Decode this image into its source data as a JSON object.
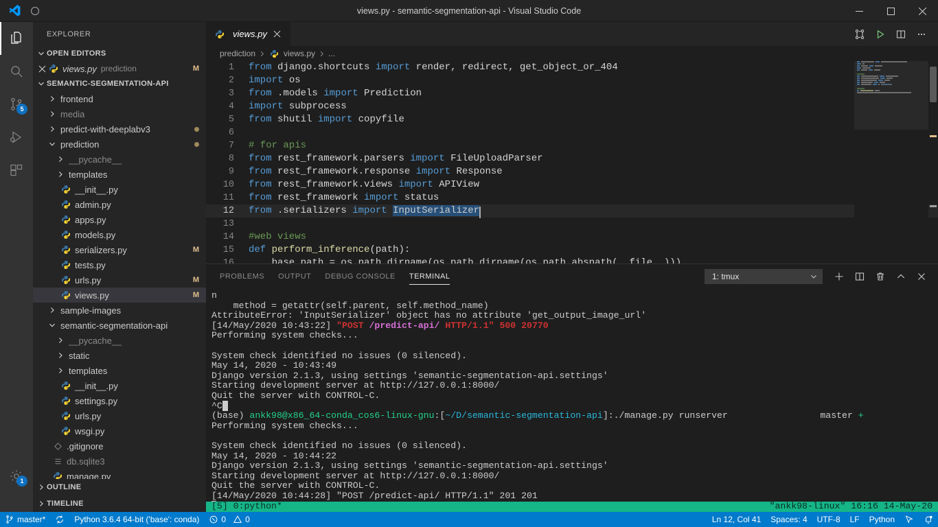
{
  "titlebar": {
    "title": "views.py - semantic-segmentation-api - Visual Studio Code",
    "logo_name": "vscode-logo",
    "minimize": "─",
    "maximize": "□",
    "close": "✕"
  },
  "activitybar": {
    "items": [
      {
        "name": "explorer",
        "icon": "files-icon",
        "badge": ""
      },
      {
        "name": "search",
        "icon": "search-icon",
        "badge": ""
      },
      {
        "name": "source-control",
        "icon": "source-control-icon",
        "badge": "5"
      },
      {
        "name": "run-and-debug",
        "icon": "run-debug-icon",
        "badge": ""
      },
      {
        "name": "extensions",
        "icon": "extensions-icon",
        "badge": ""
      }
    ],
    "bottom": [
      {
        "name": "manage",
        "icon": "gear-icon",
        "badge": "1"
      }
    ]
  },
  "sidebar": {
    "title": "EXPLORER",
    "open_editors": {
      "header": "OPEN EDITORS",
      "items": [
        {
          "name": "views.py",
          "description": "prediction",
          "badge": "M",
          "icon": "python-icon"
        }
      ]
    },
    "project": {
      "header": "SEMANTIC-SEGMENTATION-API",
      "items": [
        {
          "label": "frontend",
          "type": "folder",
          "indent": 1,
          "expanded": false,
          "badge": "",
          "dim": false
        },
        {
          "label": "media",
          "type": "folder",
          "indent": 1,
          "expanded": false,
          "badge": "",
          "dim": true
        },
        {
          "label": "predict-with-deeplabv3",
          "type": "folder",
          "indent": 1,
          "expanded": false,
          "badge": "dot",
          "dim": false
        },
        {
          "label": "prediction",
          "type": "folder",
          "indent": 1,
          "expanded": true,
          "badge": "dot",
          "dim": false
        },
        {
          "label": "__pycache__",
          "type": "folder",
          "indent": 2,
          "expanded": false,
          "badge": "",
          "dim": true
        },
        {
          "label": "templates",
          "type": "folder",
          "indent": 2,
          "expanded": false,
          "badge": "",
          "dim": false
        },
        {
          "label": "__init__.py",
          "type": "python",
          "indent": 2,
          "badge": "",
          "dim": false
        },
        {
          "label": "admin.py",
          "type": "python",
          "indent": 2,
          "badge": "",
          "dim": false
        },
        {
          "label": "apps.py",
          "type": "python",
          "indent": 2,
          "badge": "",
          "dim": false
        },
        {
          "label": "models.py",
          "type": "python",
          "indent": 2,
          "badge": "",
          "dim": false
        },
        {
          "label": "serializers.py",
          "type": "python",
          "indent": 2,
          "badge": "M",
          "dim": false
        },
        {
          "label": "tests.py",
          "type": "python",
          "indent": 2,
          "badge": "",
          "dim": false
        },
        {
          "label": "urls.py",
          "type": "python",
          "indent": 2,
          "badge": "M",
          "dim": false
        },
        {
          "label": "views.py",
          "type": "python",
          "indent": 2,
          "badge": "M",
          "dim": false,
          "selected": true
        },
        {
          "label": "sample-images",
          "type": "folder",
          "indent": 1,
          "expanded": false,
          "badge": "",
          "dim": false
        },
        {
          "label": "semantic-segmentation-api",
          "type": "folder",
          "indent": 1,
          "expanded": true,
          "badge": "",
          "dim": false
        },
        {
          "label": "__pycache__",
          "type": "folder",
          "indent": 2,
          "expanded": false,
          "badge": "",
          "dim": true
        },
        {
          "label": "static",
          "type": "folder",
          "indent": 2,
          "expanded": false,
          "badge": "",
          "dim": false
        },
        {
          "label": "templates",
          "type": "folder",
          "indent": 2,
          "expanded": false,
          "badge": "",
          "dim": false
        },
        {
          "label": "__init__.py",
          "type": "python",
          "indent": 2,
          "badge": "",
          "dim": false
        },
        {
          "label": "settings.py",
          "type": "python",
          "indent": 2,
          "badge": "",
          "dim": false
        },
        {
          "label": "urls.py",
          "type": "python",
          "indent": 2,
          "badge": "",
          "dim": false
        },
        {
          "label": "wsgi.py",
          "type": "python",
          "indent": 2,
          "badge": "",
          "dim": false
        },
        {
          "label": ".gitignore",
          "type": "git",
          "indent": 1,
          "badge": "",
          "dim": false
        },
        {
          "label": "db.sqlite3",
          "type": "db",
          "indent": 1,
          "badge": "",
          "dim": true
        },
        {
          "label": "manage.py",
          "type": "python",
          "indent": 1,
          "badge": "",
          "dim": false
        }
      ]
    },
    "outline_header": "OUTLINE",
    "timeline_header": "TIMELINE"
  },
  "editor": {
    "tab": {
      "label": "views.py",
      "icon": "python-icon",
      "close": "✕",
      "preview": true
    },
    "actions": [
      {
        "name": "open-changes-icon"
      },
      {
        "name": "run-python-file-icon"
      },
      {
        "name": "split-editor-icon"
      },
      {
        "name": "more-actions-icon"
      }
    ],
    "breadcrumb": [
      "prediction",
      "views.py",
      "..."
    ],
    "lines": [
      {
        "n": 1,
        "tokens": [
          [
            "kw",
            "from"
          ],
          [
            "pl",
            " django.shortcuts "
          ],
          [
            "kw",
            "import"
          ],
          [
            "pl",
            " render, redirect, get_object_or_404"
          ]
        ]
      },
      {
        "n": 2,
        "tokens": [
          [
            "kw",
            "import"
          ],
          [
            "pl",
            " os"
          ]
        ]
      },
      {
        "n": 3,
        "tokens": [
          [
            "kw",
            "from"
          ],
          [
            "pl",
            " .models "
          ],
          [
            "kw",
            "import"
          ],
          [
            "pl",
            " Prediction"
          ]
        ]
      },
      {
        "n": 4,
        "tokens": [
          [
            "kw",
            "import"
          ],
          [
            "pl",
            " subprocess"
          ]
        ]
      },
      {
        "n": 5,
        "tokens": [
          [
            "kw",
            "from"
          ],
          [
            "pl",
            " shutil "
          ],
          [
            "kw",
            "import"
          ],
          [
            "pl",
            " copyfile"
          ]
        ]
      },
      {
        "n": 6,
        "tokens": []
      },
      {
        "n": 7,
        "tokens": [
          [
            "cm",
            "# for apis"
          ]
        ]
      },
      {
        "n": 8,
        "tokens": [
          [
            "kw",
            "from"
          ],
          [
            "pl",
            " rest_framework.parsers "
          ],
          [
            "kw",
            "import"
          ],
          [
            "pl",
            " FileUploadParser"
          ]
        ]
      },
      {
        "n": 9,
        "tokens": [
          [
            "kw",
            "from"
          ],
          [
            "pl",
            " rest_framework.response "
          ],
          [
            "kw",
            "import"
          ],
          [
            "pl",
            " Response"
          ]
        ]
      },
      {
        "n": 10,
        "tokens": [
          [
            "kw",
            "from"
          ],
          [
            "pl",
            " rest_framework.views "
          ],
          [
            "kw",
            "import"
          ],
          [
            "pl",
            " APIView"
          ]
        ]
      },
      {
        "n": 11,
        "tokens": [
          [
            "kw",
            "from"
          ],
          [
            "pl",
            " rest_framework "
          ],
          [
            "kw",
            "import"
          ],
          [
            "pl",
            " status"
          ]
        ]
      },
      {
        "n": 12,
        "tokens": [
          [
            "kw",
            "from"
          ],
          [
            "pl",
            " .serializers "
          ],
          [
            "kw",
            "import"
          ],
          [
            "pl",
            " "
          ],
          [
            "sel",
            "InputSerializer"
          ]
        ],
        "current": true,
        "cursor": true
      },
      {
        "n": 13,
        "tokens": []
      },
      {
        "n": 14,
        "tokens": [
          [
            "cm",
            "#web views"
          ]
        ]
      },
      {
        "n": 15,
        "tokens": [
          [
            "kw",
            "def"
          ],
          [
            "fn",
            " perform_inference"
          ],
          [
            "pl",
            "(path):"
          ]
        ]
      },
      {
        "n": 16,
        "tokens": [
          [
            "pl",
            "    base_path = os.path.dirname(os.path.dirname(os.path.abspath(__file__)))"
          ]
        ]
      }
    ]
  },
  "panel": {
    "tabs": [
      {
        "label": "PROBLEMS",
        "active": false
      },
      {
        "label": "OUTPUT",
        "active": false
      },
      {
        "label": "DEBUG CONSOLE",
        "active": false
      },
      {
        "label": "TERMINAL",
        "active": true
      }
    ],
    "terminal_select": {
      "value": "1: tmux",
      "chevron": "chevron-down-icon"
    },
    "actions": [
      {
        "name": "new-terminal-icon",
        "glyph": "+"
      },
      {
        "name": "split-terminal-icon"
      },
      {
        "name": "kill-terminal-icon"
      },
      {
        "name": "maximize-panel-icon"
      },
      {
        "name": "close-panel-icon"
      }
    ],
    "terminal_lines": [
      {
        "segs": [
          [
            "plain",
            "n"
          ]
        ]
      },
      {
        "segs": [
          [
            "plain",
            "    method = getattr(self.parent, self.method_name)"
          ]
        ]
      },
      {
        "segs": [
          [
            "plain",
            "AttributeError: 'InputSerializer' object has no attribute 'get_output_image_url'"
          ]
        ]
      },
      {
        "segs": [
          [
            "plain",
            "[14/May/2020 10:43:22] "
          ],
          [
            "red",
            "\"POST "
          ],
          [
            "mag",
            "/predict-api/"
          ],
          [
            "red",
            " HTTP/1.1\" 500 20770"
          ]
        ]
      },
      {
        "segs": [
          [
            "plain",
            "Performing system checks..."
          ]
        ]
      },
      {
        "segs": [
          [
            "plain",
            ""
          ]
        ]
      },
      {
        "segs": [
          [
            "plain",
            "System check identified no issues (0 silenced)."
          ]
        ]
      },
      {
        "segs": [
          [
            "plain",
            "May 14, 2020 - 10:43:49"
          ]
        ]
      },
      {
        "segs": [
          [
            "plain",
            "Django version 2.1.3, using settings 'semantic-segmentation-api.settings'"
          ]
        ]
      },
      {
        "segs": [
          [
            "plain",
            "Starting development server at http://127.0.0.1:8000/"
          ]
        ]
      },
      {
        "segs": [
          [
            "plain",
            "Quit the server with CONTROL-C."
          ]
        ]
      },
      {
        "segs": [
          [
            "plain",
            "^C"
          ],
          [
            "cursorblock",
            " "
          ]
        ]
      },
      {
        "segs": [
          [
            "plain",
            "(base) "
          ],
          [
            "green",
            "ankk98@x86_64-conda_cos6-linux-gnu"
          ],
          [
            "plain",
            ":["
          ],
          [
            "cyan",
            "~/D/semantic-segmentation-api"
          ],
          [
            "plain",
            "]:./manage.py runserver"
          ],
          [
            "pad",
            "                 "
          ],
          [
            "plain",
            "master "
          ],
          [
            "green",
            "+"
          ]
        ]
      },
      {
        "segs": [
          [
            "plain",
            "Performing system checks..."
          ]
        ]
      },
      {
        "segs": [
          [
            "plain",
            ""
          ]
        ]
      },
      {
        "segs": [
          [
            "plain",
            "System check identified no issues (0 silenced)."
          ]
        ]
      },
      {
        "segs": [
          [
            "plain",
            "May 14, 2020 - 10:44:22"
          ]
        ]
      },
      {
        "segs": [
          [
            "plain",
            "Django version 2.1.3, using settings 'semantic-segmentation-api.settings'"
          ]
        ]
      },
      {
        "segs": [
          [
            "plain",
            "Starting development server at http://127.0.0.1:8000/"
          ]
        ]
      },
      {
        "segs": [
          [
            "plain",
            "Quit the server with CONTROL-C."
          ]
        ]
      },
      {
        "segs": [
          [
            "plain",
            "[14/May/2020 10:44:28] \"POST /predict-api/ HTTP/1.1\" 201 201"
          ]
        ]
      },
      {
        "segs": [
          [
            "cursoroutline",
            ""
          ]
        ]
      }
    ],
    "tmux": {
      "left": "[5] 0:python*",
      "right": "\"ankk98-linux\" 16:16 14-May-20"
    }
  },
  "statusbar": {
    "left": [
      {
        "name": "branch",
        "icon": "source-control-icon",
        "label": "master*"
      },
      {
        "name": "sync",
        "icon": "sync-icon",
        "label": ""
      },
      {
        "name": "python-interpreter",
        "icon": "",
        "label": "Python 3.6.4 64-bit ('base': conda)"
      },
      {
        "name": "errors",
        "icon": "error-icon",
        "label": "0"
      },
      {
        "name": "warnings",
        "icon": "warning-icon",
        "label": "0"
      }
    ],
    "right": [
      {
        "name": "cursor-position",
        "label": "Ln 12, Col 41"
      },
      {
        "name": "indentation",
        "label": "Spaces: 4"
      },
      {
        "name": "encoding",
        "label": "UTF-8"
      },
      {
        "name": "eol",
        "label": "LF"
      },
      {
        "name": "language-mode",
        "label": "Python"
      },
      {
        "name": "feedback",
        "icon": "feedback-icon",
        "label": ""
      },
      {
        "name": "notifications",
        "icon": "bell-icon",
        "label": ""
      }
    ]
  },
  "colors": {
    "accent": "#007acc",
    "titlebar_bg": "#252526",
    "editor_bg": "#1e1e1e",
    "sidebar_bg": "#252526",
    "activitybar_bg": "#333333",
    "modified_badge": "#e2c08d",
    "tmux_bar": "#15b588"
  }
}
